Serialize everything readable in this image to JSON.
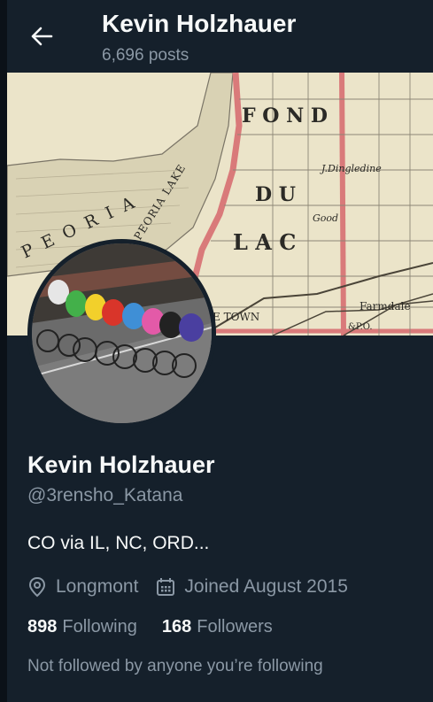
{
  "header": {
    "title": "Kevin Holzhauer",
    "posts_count": "6,696 posts",
    "back_icon": "arrow-left-icon"
  },
  "banner": {
    "map_labels": {
      "peoria": "P E O R I A",
      "peoria_lake": "PEORIA LAKE",
      "fond": "F O N D",
      "du": "D U",
      "lac": "L A C",
      "town": "E TOWN",
      "dingledine": "J.Dingledine",
      "good": "Good",
      "farmdale": "Farmdale",
      "rail": "&P.O."
    }
  },
  "profile": {
    "name": "Kevin Holzhauer",
    "handle": "@3rensho_Katana",
    "bio": "CO via IL, NC, ORD...",
    "location": "Longmont",
    "joined": "Joined August 2015",
    "location_icon": "map-pin-icon",
    "calendar_icon": "calendar-icon"
  },
  "stats": {
    "following_count": "898",
    "following_label": "Following",
    "followers_count": "168",
    "followers_label": "Followers"
  },
  "social_context": "Not followed by anyone you’re following",
  "colors": {
    "background": "#15202b",
    "text_primary": "#f7f9f9",
    "text_secondary": "#8b98a5"
  }
}
